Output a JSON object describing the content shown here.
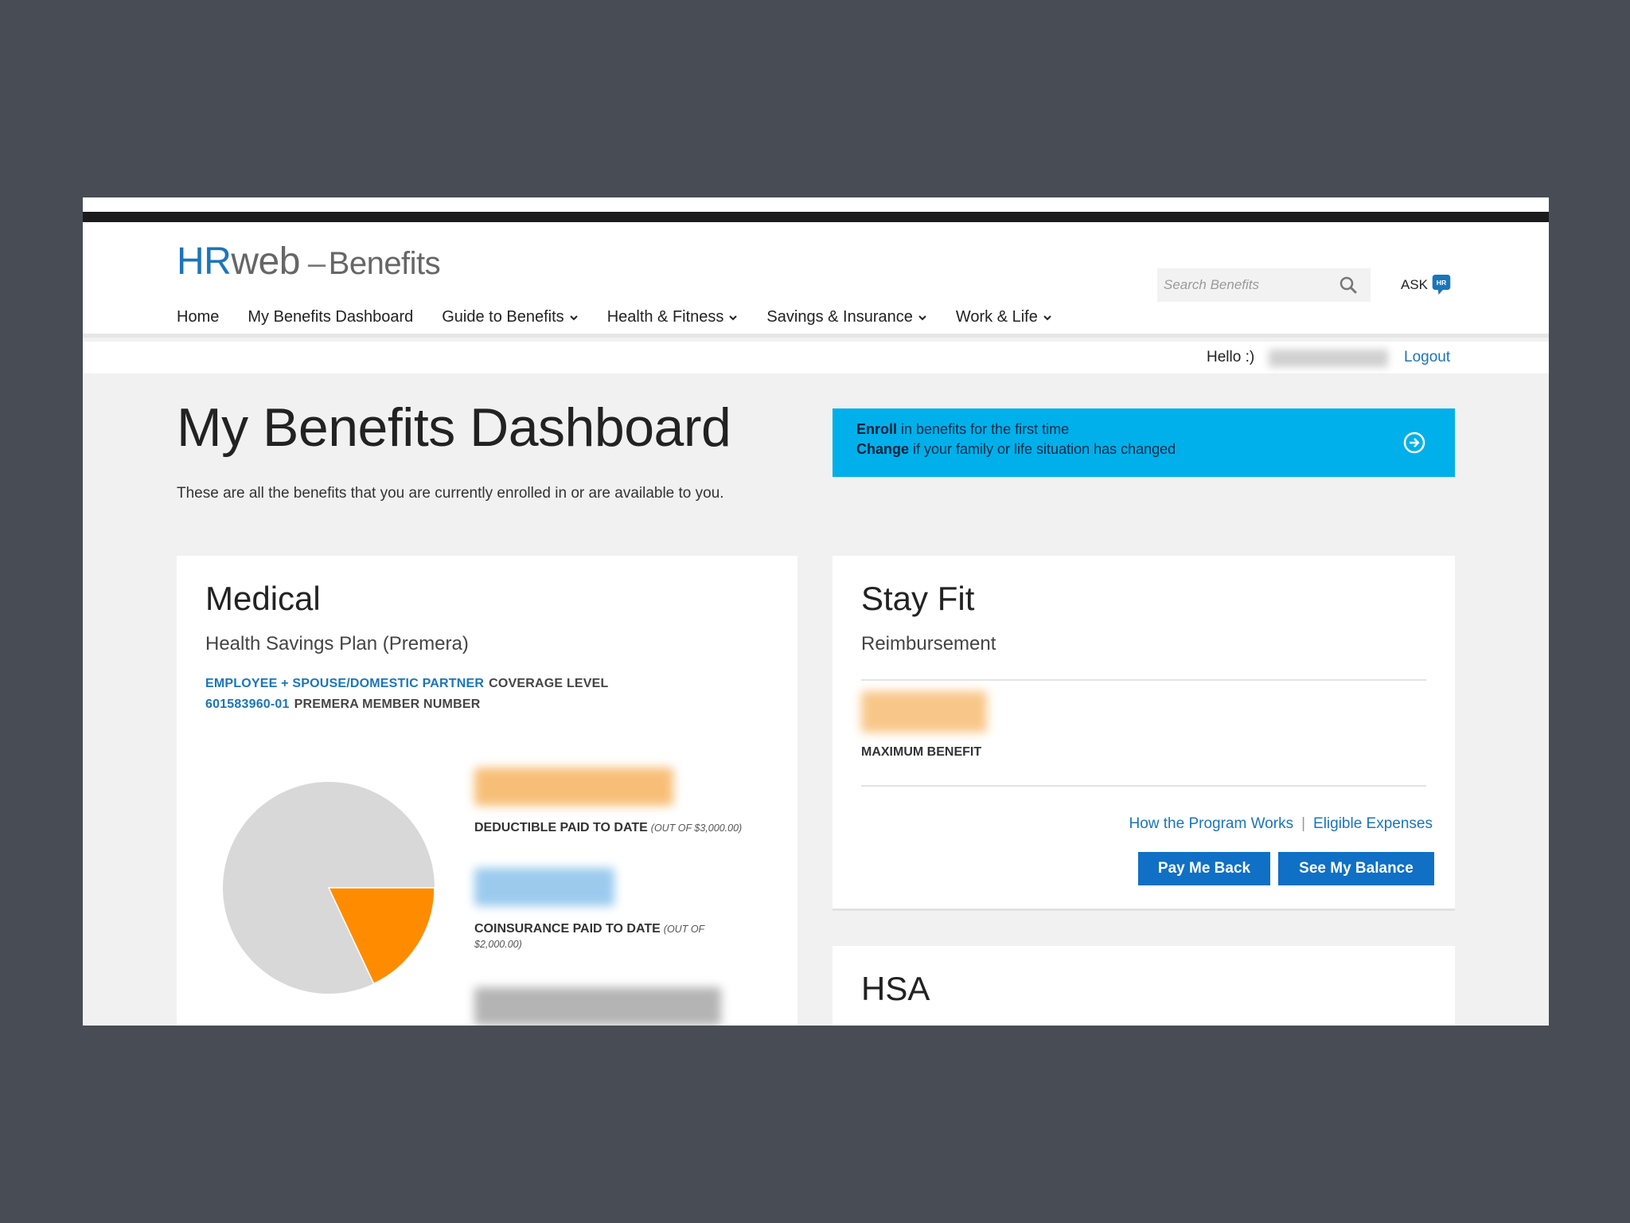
{
  "header": {
    "logo": {
      "hr": "HR",
      "web": "web",
      "dash": "–",
      "section": "Benefits"
    },
    "search": {
      "placeholder": "Search Benefits",
      "icon": "search-icon"
    },
    "ask": {
      "label": "ASK",
      "badge": "HR"
    },
    "nav": [
      {
        "label": "Home",
        "dropdown": false
      },
      {
        "label": "My Benefits Dashboard",
        "dropdown": false
      },
      {
        "label": "Guide to Benefits",
        "dropdown": true
      },
      {
        "label": "Health & Fitness",
        "dropdown": true
      },
      {
        "label": "Savings & Insurance",
        "dropdown": true
      },
      {
        "label": "Work & Life",
        "dropdown": true
      }
    ]
  },
  "userbar": {
    "greeting": "Hello :)",
    "logout": "Logout"
  },
  "page": {
    "title": "My Benefits Dashboard",
    "description": "These are all the benefits that you are currently enrolled in or are available to you."
  },
  "enroll_banner": {
    "line1_bold": "Enroll",
    "line1_rest": " in benefits for the first time",
    "line2_bold": "Change",
    "line2_rest": " if your family or life situation has changed"
  },
  "medical": {
    "title": "Medical",
    "plan": "Health Savings Plan (Premera)",
    "coverage_value": "EMPLOYEE + SPOUSE/DOMESTIC PARTNER",
    "coverage_label": "COVERAGE LEVEL",
    "member_value": "601583960-01",
    "member_label": "PREMERA MEMBER NUMBER",
    "deductible_label": "DEDUCTIBLE PAID TO DATE",
    "deductible_note": "(OUT OF $3,000.00)",
    "coinsurance_label": "COINSURANCE PAID TO DATE",
    "coinsurance_note_a": "(OUT OF",
    "coinsurance_note_b": "$2,000.00)",
    "pie_fraction_orange": 0.18,
    "colors": {
      "pie_base": "#d8d8d8",
      "pie_accent": "#ff8c00"
    }
  },
  "stay_fit": {
    "title": "Stay Fit",
    "subtitle": "Reimbursement",
    "max_label": "MAXIMUM BENEFIT",
    "link1": "How the Program Works",
    "link_sep": "|",
    "link2": "Eligible Expenses",
    "btn_pay": "Pay Me Back",
    "btn_balance": "See My Balance"
  },
  "hsa": {
    "title": "HSA"
  },
  "colors": {
    "brand_blue": "#1b75bb",
    "banner_cyan": "#00b0ea",
    "button_blue": "#0f70c5"
  }
}
